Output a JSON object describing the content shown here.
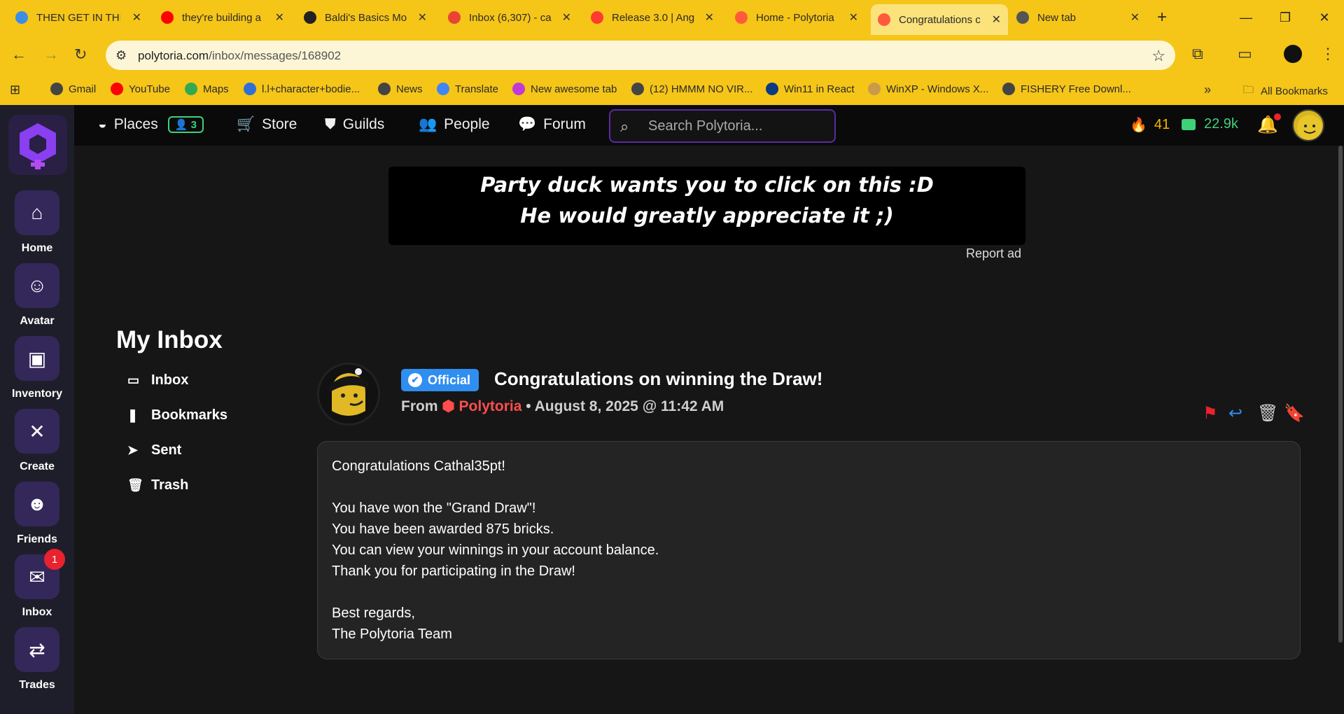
{
  "browser": {
    "tabs": [
      {
        "title": "THEN GET IN THE",
        "color": "#3a8ee6"
      },
      {
        "title": "they're building a",
        "color": "#ff0000"
      },
      {
        "title": "Baldi's Basics Mo",
        "color": "#222222"
      },
      {
        "title": "Inbox (6,307) - ca",
        "color": "#ea4335"
      },
      {
        "title": "Release 3.0 | Ang",
        "color": "#ff3b2f"
      },
      {
        "title": "Home - Polytoria",
        "color": "#ff5a3c"
      },
      {
        "title": "Congratulations c",
        "color": "#ff5a3c"
      },
      {
        "title": "New tab",
        "color": "#555555"
      }
    ],
    "new_tab": "+",
    "url_host": "polytoria.com",
    "url_path": "/inbox/messages/168902",
    "bookmarks": [
      {
        "label": "Gmail",
        "color": "#444"
      },
      {
        "label": "YouTube",
        "color": "#ff0000"
      },
      {
        "label": "Maps",
        "color": "#34a853"
      },
      {
        "label": "l.l+character+bodie...",
        "color": "#2f6fd6"
      },
      {
        "label": "News",
        "color": "#444"
      },
      {
        "label": "Translate",
        "color": "#4285f4"
      },
      {
        "label": "New awesome tab",
        "color": "#c03ad6"
      },
      {
        "label": "(12) HMMM NO VIR...",
        "color": "#444"
      },
      {
        "label": "Win11 in React",
        "color": "#0b3b80"
      },
      {
        "label": "WinXP - Windows X...",
        "color": "#c89a4a"
      },
      {
        "label": "FISHERY Free Downl...",
        "color": "#444"
      }
    ],
    "all_bookmarks": "All Bookmarks",
    "more": "»"
  },
  "sidebar": {
    "items": [
      {
        "label": "Home",
        "icon": "home-icon",
        "glyph": "⌂"
      },
      {
        "label": "Avatar",
        "icon": "avatar-icon",
        "glyph": "☺"
      },
      {
        "label": "Inventory",
        "icon": "backpack-icon",
        "glyph": "▣"
      },
      {
        "label": "Create",
        "icon": "tools-icon",
        "glyph": "✕"
      },
      {
        "label": "Friends",
        "icon": "friends-icon",
        "glyph": "☻"
      },
      {
        "label": "Inbox",
        "icon": "inbox-icon",
        "glyph": "✉",
        "badge": "1"
      },
      {
        "label": "Trades",
        "icon": "handshake-icon",
        "glyph": "⇄"
      }
    ]
  },
  "topnav": {
    "places": "Places",
    "friends_online": "3",
    "store": "Store",
    "guilds": "Guilds",
    "people": "People",
    "forum": "Forum",
    "search_placeholder": "Search Polytoria...",
    "stars": "41",
    "bricks": "22.9k",
    "stars_color": "#f5b800",
    "bricks_color": "#3fd07a"
  },
  "ad": {
    "line1": "Party duck wants you to click on this :D",
    "line2": "He would greatly appreciate it ;)",
    "report": "Report ad"
  },
  "inbox": {
    "title": "My Inbox",
    "nav": [
      "Inbox",
      "Bookmarks",
      "Sent",
      "Trash"
    ]
  },
  "message": {
    "badge": "Official",
    "subject": "Congratulations on winning the Draw!",
    "from_label": "From",
    "sender": "Polytoria",
    "date": "• August 8, 2025 @ 11:42 AM",
    "body": [
      "Congratulations Cathal35pt!",
      "",
      "You have won the \"Grand Draw\"!",
      "You have been awarded 875 bricks.",
      "You can view your winnings in your account balance.",
      "Thank you for participating in the Draw!",
      "",
      "Best regards,",
      "The Polytoria Team"
    ]
  }
}
